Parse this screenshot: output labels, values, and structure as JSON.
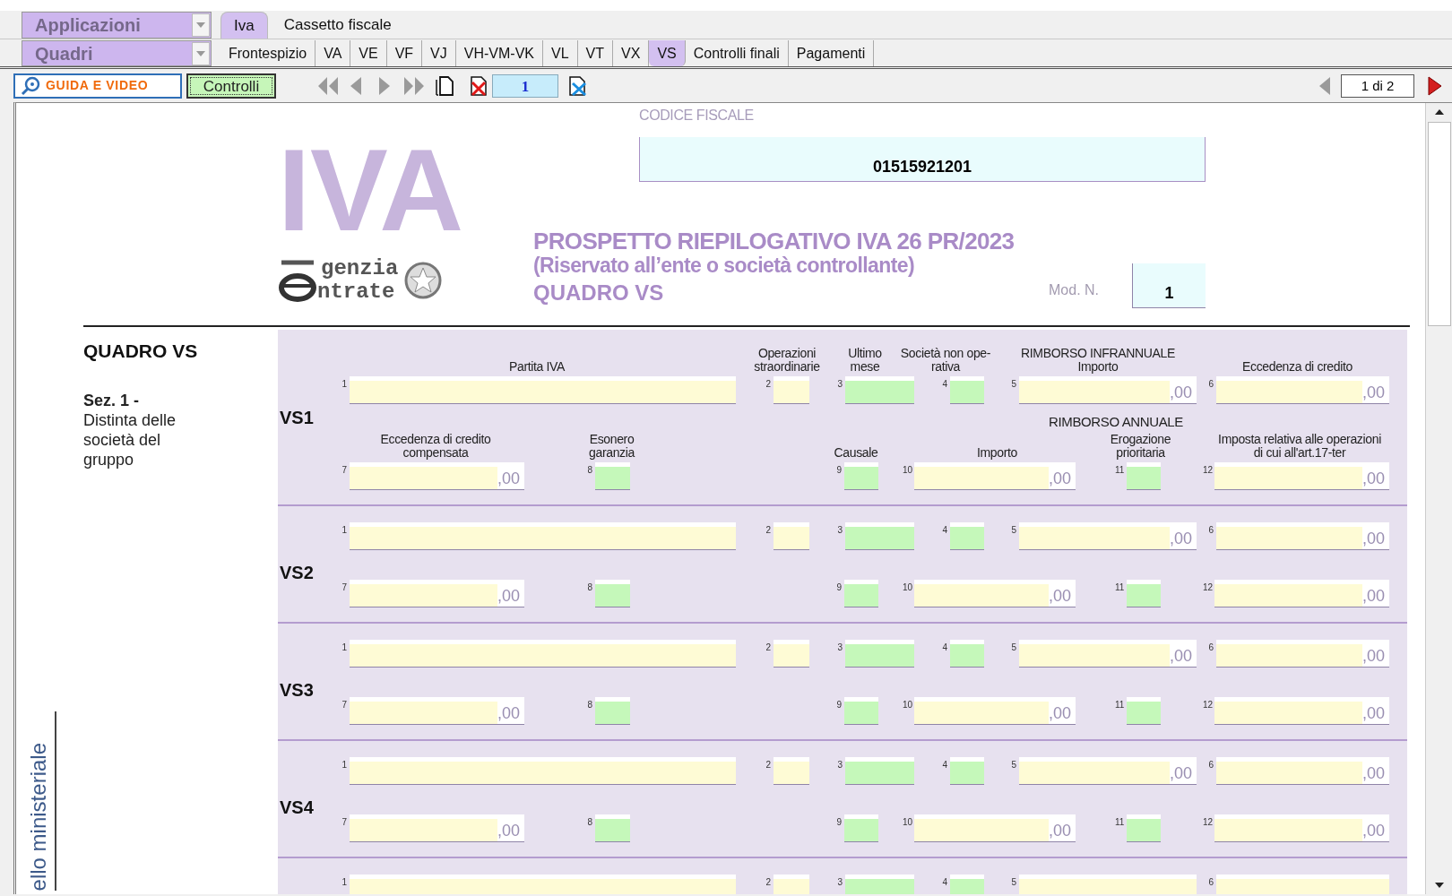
{
  "menus": [
    {
      "label": "Applicazioni"
    },
    {
      "label": "Quadri"
    }
  ],
  "app_tabs": [
    {
      "label": "Iva",
      "selected": true
    },
    {
      "label": "Cassetto fiscale",
      "selected": false
    }
  ],
  "section_tabs": [
    {
      "label": "Frontespizio",
      "selected": false
    },
    {
      "label": "VA",
      "selected": false
    },
    {
      "label": "VE",
      "selected": false
    },
    {
      "label": "VF",
      "selected": false
    },
    {
      "label": "VJ",
      "selected": false
    },
    {
      "label": "VH-VM-VK",
      "selected": false
    },
    {
      "label": "VL",
      "selected": false
    },
    {
      "label": "VT",
      "selected": false
    },
    {
      "label": "VX",
      "selected": false
    },
    {
      "label": "VS",
      "selected": true
    },
    {
      "label": "Controlli finali",
      "selected": false
    },
    {
      "label": "Pagamenti",
      "selected": false
    }
  ],
  "toolbar": {
    "help_button": "GUIDA E VIDEO",
    "check_button": "Controlli",
    "page_field": "1",
    "page_indicator": "1 di 2"
  },
  "form": {
    "logo": "IVA",
    "agency": [
      "genzia",
      "ntrate"
    ],
    "tax_code_label": "CODICE FISCALE",
    "tax_code": "01515921201",
    "title": "PROSPETTO RIEPILOGATIVO IVA 26 PR/2023",
    "subtitle": "(Riservato all’ente o società controllante)",
    "quadro_title": "QUADRO VS",
    "model_label": "Mod. N.",
    "model_number": "1",
    "section_title": "QUADRO VS",
    "section_description": "**Sez. 1 -** Distinta delle società del gruppo",
    "side_text": "ello ministeriale",
    "group_label": "RIMBORSO ANNUALE",
    "rows": [
      {
        "code": "VS1",
        "fields": [
          {
            "number": "1",
            "kind": "text",
            "label": "Partita IVA"
          },
          {
            "number": "2",
            "kind": "text",
            "label": "Operazioni\nstraordinarie"
          },
          {
            "number": "3",
            "kind": "check",
            "label": "Ultimo\nmese"
          },
          {
            "number": "4",
            "kind": "check",
            "label": "Società non ope-\nrativa"
          },
          {
            "number": "5",
            "kind": "amount",
            "suffix": ",00",
            "label": "RIMBORSO INFRANNUALE\nImporto"
          },
          {
            "number": "6",
            "kind": "amount",
            "suffix": ",00",
            "label": "Eccedenza di credito"
          },
          {
            "number": "7",
            "kind": "amount",
            "suffix": ",00",
            "label": "Eccedenza di credito\ncompensata"
          },
          {
            "number": "8",
            "kind": "check",
            "label": "Esonero\ngaranzia"
          },
          {
            "number": "9",
            "kind": "check",
            "label": "Causale"
          },
          {
            "number": "10",
            "kind": "amount",
            "suffix": ",00",
            "label": "Importo"
          },
          {
            "number": "11",
            "kind": "check",
            "label": "Erogazione\nprioritaria"
          },
          {
            "number": "12",
            "kind": "amount",
            "suffix": ",00",
            "label": "Imposta relativa alle operazioni\ndi cui all'art.17-ter"
          }
        ]
      },
      {
        "code": "VS2",
        "fields": [
          {
            "number": "1",
            "kind": "text"
          },
          {
            "number": "2",
            "kind": "text"
          },
          {
            "number": "3",
            "kind": "check"
          },
          {
            "number": "4",
            "kind": "check"
          },
          {
            "number": "5",
            "kind": "amount",
            "suffix": ",00"
          },
          {
            "number": "6",
            "kind": "amount",
            "suffix": ",00"
          },
          {
            "number": "7",
            "kind": "amount",
            "suffix": ",00"
          },
          {
            "number": "8",
            "kind": "check"
          },
          {
            "number": "9",
            "kind": "check"
          },
          {
            "number": "10",
            "kind": "amount",
            "suffix": ",00"
          },
          {
            "number": "11",
            "kind": "check"
          },
          {
            "number": "12",
            "kind": "amount",
            "suffix": ",00"
          }
        ]
      },
      {
        "code": "VS3",
        "fields": [
          {
            "number": "1",
            "kind": "text"
          },
          {
            "number": "2",
            "kind": "text"
          },
          {
            "number": "3",
            "kind": "check"
          },
          {
            "number": "4",
            "kind": "check"
          },
          {
            "number": "5",
            "kind": "amount",
            "suffix": ",00"
          },
          {
            "number": "6",
            "kind": "amount",
            "suffix": ",00"
          },
          {
            "number": "7",
            "kind": "amount",
            "suffix": ",00"
          },
          {
            "number": "8",
            "kind": "check"
          },
          {
            "number": "9",
            "kind": "check"
          },
          {
            "number": "10",
            "kind": "amount",
            "suffix": ",00"
          },
          {
            "number": "11",
            "kind": "check"
          },
          {
            "number": "12",
            "kind": "amount",
            "suffix": ",00"
          }
        ]
      },
      {
        "code": "VS4",
        "fields": [
          {
            "number": "1",
            "kind": "text"
          },
          {
            "number": "2",
            "kind": "text"
          },
          {
            "number": "3",
            "kind": "check"
          },
          {
            "number": "4",
            "kind": "check"
          },
          {
            "number": "5",
            "kind": "amount",
            "suffix": ",00"
          },
          {
            "number": "6",
            "kind": "amount",
            "suffix": ",00"
          },
          {
            "number": "7",
            "kind": "amount",
            "suffix": ",00"
          },
          {
            "number": "8",
            "kind": "check"
          },
          {
            "number": "9",
            "kind": "check"
          },
          {
            "number": "10",
            "kind": "amount",
            "suffix": ",00"
          },
          {
            "number": "11",
            "kind": "check"
          },
          {
            "number": "12",
            "kind": "amount",
            "suffix": ",00"
          }
        ]
      },
      {
        "fields": [
          {
            "number": "1",
            "kind": "text"
          },
          {
            "number": "2",
            "kind": "text"
          },
          {
            "number": "3",
            "kind": "check"
          },
          {
            "number": "4",
            "kind": "check"
          },
          {
            "number": "5",
            "kind": "text"
          },
          {
            "number": "6",
            "kind": "text"
          }
        ]
      }
    ]
  }
}
